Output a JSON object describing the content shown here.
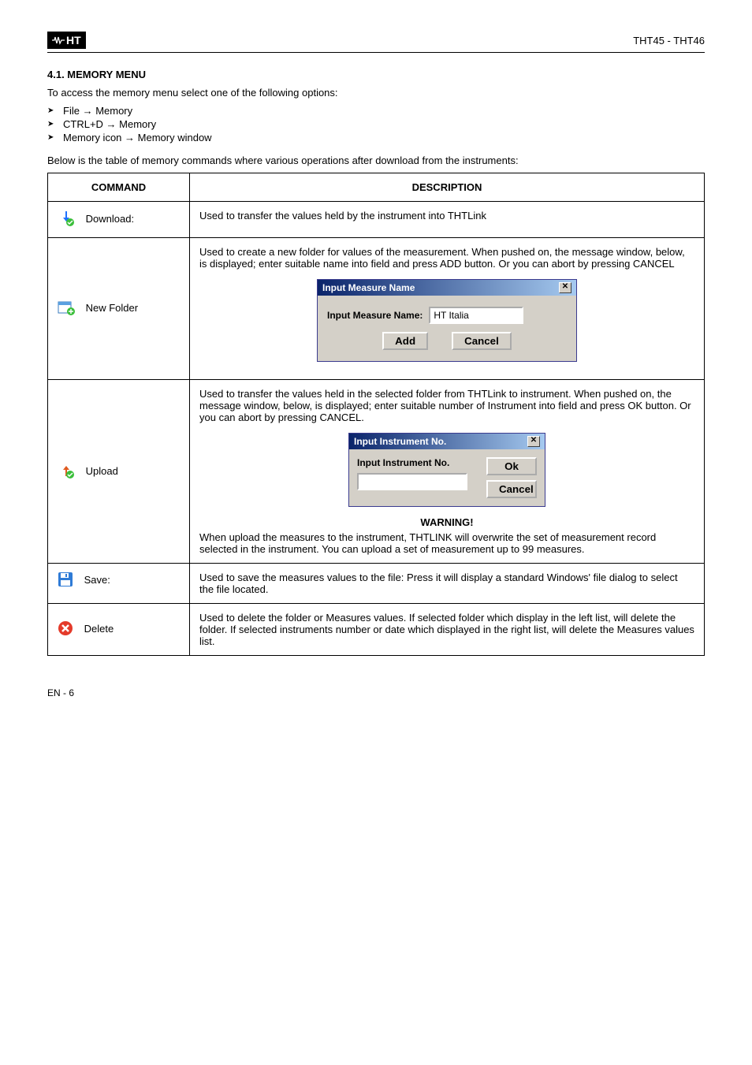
{
  "header": {
    "product": "THT45 - THT46"
  },
  "section41": {
    "title": "4.1. MEMORY MENU",
    "intro": "To access the memory menu select one of the following options:",
    "bullets": [
      {
        "a": "File",
        "b": "Memory"
      },
      {
        "a": "CTRL+D",
        "b": "Memory"
      },
      {
        "a": "Memory icon",
        "b": "Memory window"
      }
    ],
    "note": "Below is the table of memory commands where various operations after download from the instruments:"
  },
  "table": {
    "h1": "COMMAND",
    "h2": "DESCRIPTION",
    "rows": {
      "download": {
        "label": "Download:",
        "desc": "Used to transfer the values held by the instrument into THTLink"
      },
      "newfolder": {
        "label": "New Folder",
        "desc": "Used to create a new folder for values of the measurement. When pushed on, the message window, below, is displayed; enter suitable name into field and press ADD button. Or you can abort by pressing CANCEL",
        "dialog": {
          "title": "Input Measure Name",
          "field": "Input Measure Name:",
          "value": "HT Italia",
          "btnAdd": "Add",
          "btnCancel": "Cancel"
        }
      },
      "upload": {
        "label": "Upload",
        "desc": "Used to transfer the values held in the selected folder from THTLink to instrument. When pushed on, the message window, below, is displayed; enter suitable number of Instrument into field and press OK button. Or you can abort by pressing CANCEL.",
        "dialog": {
          "title": "Input Instrument No.",
          "field": "Input Instrument No.",
          "btnOk": "Ok",
          "btnCancel": "Cancel"
        },
        "warnTitle": "WARNING!",
        "warnText": "When upload the measures to the instrument, THTLINK will overwrite the set of measurement record selected in the instrument. You can upload a set of measurement up to 99 measures."
      },
      "save": {
        "label": "Save:",
        "desc": "Used to save the measures values to the file: Press it will display a standard Windows' file dialog to select the file located."
      },
      "delete": {
        "label": "Delete",
        "desc": "Used to delete the folder or Measures values. If selected folder which display in the left list, will delete the folder. If selected instruments number or date which displayed in the right list, will delete the Measures values list."
      }
    }
  },
  "footer": {
    "left": "EN - 6",
    "right": ""
  }
}
